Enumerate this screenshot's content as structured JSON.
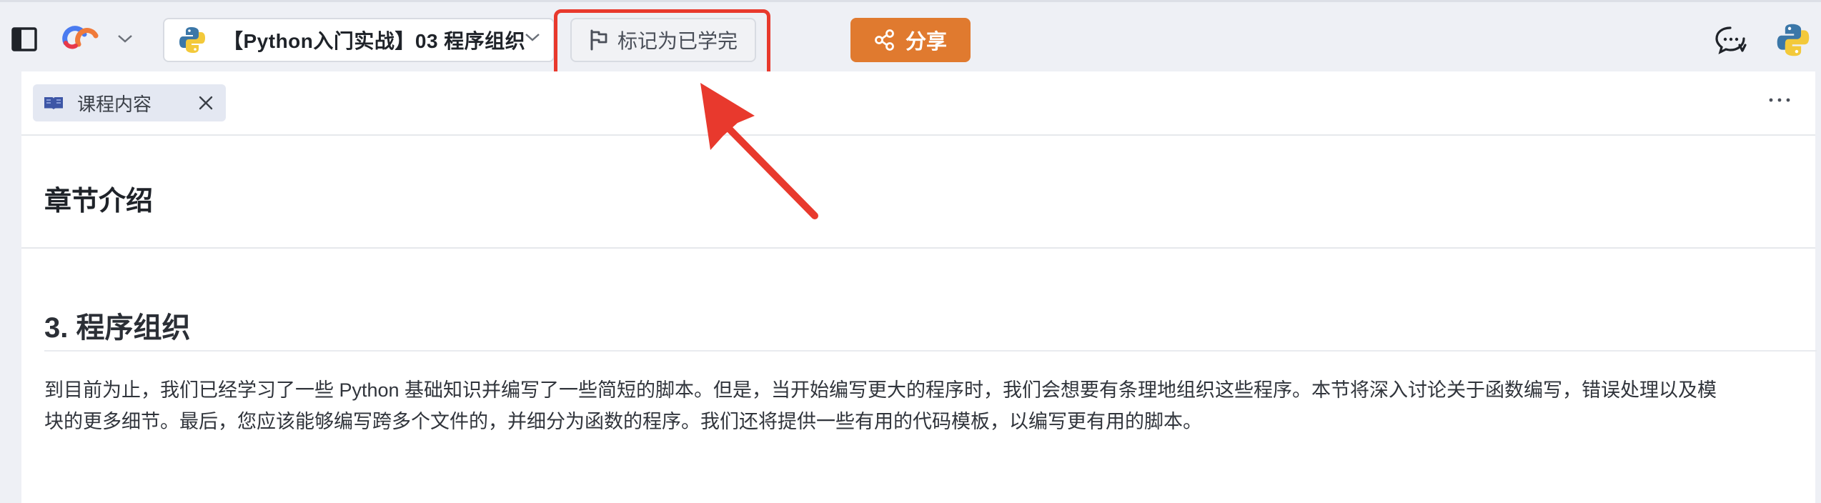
{
  "header": {
    "course_title": "【Python入门实战】03 程序组织",
    "mark_complete_label": "标记为已学完",
    "share_label": "分享"
  },
  "tabs": [
    {
      "label": "课程内容"
    }
  ],
  "content": {
    "section_title": "章节介绍",
    "chapter_heading": "3. 程序组织",
    "paragraph_line1": "到目前为止，我们已经学习了一些 Python 基础知识并编写了一些简短的脚本。但是，当开始编写更大的程序时，我们会想要有条理地组织这些程序。本节将深入讨论关于函数编写，错误处理以及模",
    "paragraph_line2": "块的更多细节。最后，您应该能够编写跨多个文件的，并细分为函数的程序。我们还将提供一些有用的代码模板，以编写更有用的脚本。"
  },
  "colors": {
    "share_bg": "#e07a2f",
    "annotation_red": "#e8392d",
    "tab_bg": "#e4e8f2",
    "page_bg": "#eef0f5"
  },
  "icons": [
    "sidebar-toggle-icon",
    "app-logo-icon",
    "chevron-down-icon",
    "python-icon",
    "flag-icon",
    "share-icon",
    "chat-icon",
    "book-icon",
    "close-icon",
    "more-icon"
  ]
}
